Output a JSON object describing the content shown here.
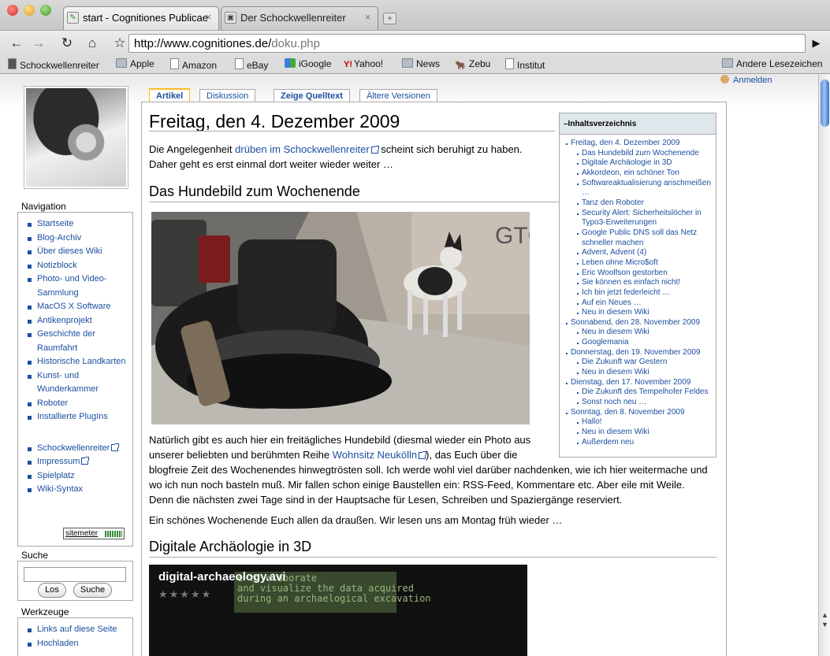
{
  "browser": {
    "tabs": [
      {
        "title": "start - Cognitiones Publicae"
      },
      {
        "title": "Der Schockwellenreiter"
      }
    ],
    "url_host": "http://www.cognitiones.de/",
    "url_path": "doku.php",
    "bookmarks": [
      "Schockwellenreiter",
      "Apple",
      "Amazon",
      "eBay",
      "iGoogle",
      "Yahoo!",
      "News",
      "Zebu",
      "Institut"
    ],
    "other_bookmarks": "Andere Lesezeichen"
  },
  "user": {
    "login": "Anmelden"
  },
  "sidebar": {
    "nav_title": "Navigation",
    "nav_items": [
      "Startseite",
      "Blog-Archiv",
      "Über dieses Wiki",
      "Notizblock",
      "Photo- und Video-Sammlung",
      "MacOS X Software",
      "Antikenprojekt",
      "Geschichte der Raumfahrt",
      "Historische Landkarten",
      "Kunst- und Wunderkammer",
      "Roboter",
      "Installierte PlugIns"
    ],
    "ext_items": [
      "Schockwellenreiter",
      "Impressum",
      "Spielplatz",
      "Wiki-Syntax"
    ],
    "sitemeter": "sitemeter",
    "search_title": "Suche",
    "search_go": "Los",
    "search_btn": "Suche",
    "tools_title": "Werkzeuge",
    "tools_items": [
      "Links auf diese Seite",
      "Hochladen"
    ]
  },
  "page_tabs": [
    "Artikel",
    "Diskussion",
    "Zeige Quelltext",
    "Ältere Versionen"
  ],
  "article": {
    "title": "Freitag, den 4. Dezember 2009",
    "p1a": "Die Angelegenheit ",
    "p1link": "drüben im Schockwellenreiter",
    "p1b": " scheint sich beruhigt zu haben.",
    "p1c": "Daher geht es erst einmal dort weiter wieder weiter …",
    "h2a": "Das Hundebild zum Wochenende",
    "p2a": "Natürlich gibt es auch hier ein freitägliches Hundebild (diesmal wieder ein Photo aus",
    "p2b": "unserer beliebten und berühmten Reihe ",
    "p2link": "Wohnsitz Neukölln",
    "p2c": "), das Euch über die",
    "p2d": "blogfreie Zeit des Wochenendes hinwegtrösten soll. Ich werde wohl viel darüber nachdenken, wie ich hier weitermache und",
    "p2e": "wo ich nun noch basteln muß. Mir fallen schon einige Baustellen ein: RSS-Feed, Kommentare etc. Aber eile mit Weile.",
    "p2f": "Denn die nächsten zwei Tage sind in der Hauptsache für Lesen, Schreiben und Spaziergänge reserviert.",
    "p3": "Ein schönes Wochenende Euch allen da draußen. Wir lesen uns am Montag früh wieder …",
    "h2b": "Digitale Archäologie in 3D",
    "video_title": "digital-archaeology.avi",
    "video_overlay": "e to elaborate\nand visualize the data acquired\nduring an archaelogical excavation"
  },
  "toc": {
    "title": "–Inhaltsverzeichnis",
    "items": [
      {
        "t": "Freitag, den 4. Dezember 2009",
        "l": 1
      },
      {
        "t": "Das Hundebild zum Wochenende",
        "l": 2
      },
      {
        "t": "Digitale Archäologie in 3D",
        "l": 2
      },
      {
        "t": "Akkordeon, ein schöner Ton",
        "l": 2
      },
      {
        "t": "Softwareaktualisierung anschmeißen …",
        "l": 2
      },
      {
        "t": "Tanz den Roboter",
        "l": 2
      },
      {
        "t": "Security Alert: Sicherheitslöcher in Typo3-Erweiterungen",
        "l": 2
      },
      {
        "t": "Google Public DNS soll das Netz schneller machen",
        "l": 2
      },
      {
        "t": "Advent, Advent (4)",
        "l": 2
      },
      {
        "t": "Leben ohne Micro$oft",
        "l": 2
      },
      {
        "t": "Eric Woolfson gestorben",
        "l": 2
      },
      {
        "t": "Sie können es einfach nicht!",
        "l": 2
      },
      {
        "t": "Ich bin jetzt federleicht …",
        "l": 2
      },
      {
        "t": "Auf ein Neues …",
        "l": 2
      },
      {
        "t": "Neu in diesem Wiki",
        "l": 2
      },
      {
        "t": "Sonnabend, den 28. November 2009",
        "l": 1
      },
      {
        "t": "Neu in diesem Wiki",
        "l": 2
      },
      {
        "t": "Googlemania",
        "l": 2
      },
      {
        "t": "Donnerstag, den 19. November 2009",
        "l": 1
      },
      {
        "t": "Die Zukunft war Gestern",
        "l": 2
      },
      {
        "t": "Neu in diesem Wiki",
        "l": 2
      },
      {
        "t": "Dienstag, den 17. November 2009",
        "l": 1
      },
      {
        "t": "Die Zukunft des Tempelhofer Feldes",
        "l": 2
      },
      {
        "t": "Sonst noch neu …",
        "l": 2
      },
      {
        "t": "Sonntag, den 8. November 2009",
        "l": 1
      },
      {
        "t": "Hallo!",
        "l": 2
      },
      {
        "t": "Neu in diesem Wiki",
        "l": 2
      },
      {
        "t": "Außerdem neu",
        "l": 2
      }
    ]
  }
}
